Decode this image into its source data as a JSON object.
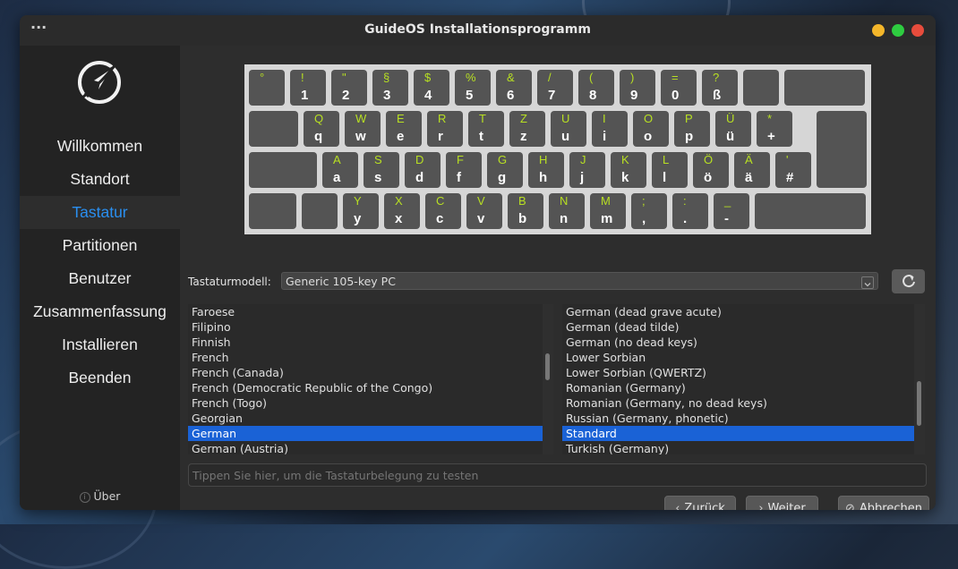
{
  "window": {
    "title": "GuideOS Installationsprogramm",
    "menu_glyph": "···",
    "controls": {
      "minimize_color": "#f4b62a",
      "maximize_color": "#2ecc40",
      "close_color": "#e74c3c"
    }
  },
  "sidebar": {
    "items": [
      {
        "label": "Willkommen",
        "active": false
      },
      {
        "label": "Standort",
        "active": false
      },
      {
        "label": "Tastatur",
        "active": true
      },
      {
        "label": "Partitionen",
        "active": false
      },
      {
        "label": "Benutzer",
        "active": false
      },
      {
        "label": "Zusammenfassung",
        "active": false
      },
      {
        "label": "Installieren",
        "active": false
      },
      {
        "label": "Beenden",
        "active": false
      }
    ],
    "about_label": "Über",
    "active_color": "#2a8ff0"
  },
  "keyboard": {
    "rows": [
      [
        [
          "°",
          ""
        ],
        [
          "!",
          "1"
        ],
        [
          "\"",
          "2"
        ],
        [
          "§",
          "3"
        ],
        [
          "$",
          "4"
        ],
        [
          "%",
          "5"
        ],
        [
          "&",
          "6"
        ],
        [
          "/",
          "7"
        ],
        [
          "(",
          "8"
        ],
        [
          ")",
          "9"
        ],
        [
          "=",
          "0"
        ],
        [
          "?",
          "ß"
        ],
        [
          "",
          ""
        ],
        [
          "",
          ""
        ]
      ],
      [
        [
          "",
          ""
        ],
        [
          "Q",
          "q"
        ],
        [
          "W",
          "w"
        ],
        [
          "E",
          "e"
        ],
        [
          "R",
          "r"
        ],
        [
          "T",
          "t"
        ],
        [
          "Z",
          "z"
        ],
        [
          "U",
          "u"
        ],
        [
          "I",
          "i"
        ],
        [
          "O",
          "o"
        ],
        [
          "P",
          "p"
        ],
        [
          "Ü",
          "ü"
        ],
        [
          "*",
          "+"
        ],
        [
          "",
          ""
        ]
      ],
      [
        [
          "",
          ""
        ],
        [
          "A",
          "a"
        ],
        [
          "S",
          "s"
        ],
        [
          "D",
          "d"
        ],
        [
          "F",
          "f"
        ],
        [
          "G",
          "g"
        ],
        [
          "H",
          "h"
        ],
        [
          "J",
          "j"
        ],
        [
          "K",
          "k"
        ],
        [
          "L",
          "l"
        ],
        [
          "Ö",
          "ö"
        ],
        [
          "Ä",
          "ä"
        ],
        [
          "'",
          "#"
        ]
      ],
      [
        [
          "",
          ""
        ],
        [
          "",
          ""
        ],
        [
          "Y",
          "y"
        ],
        [
          "X",
          "x"
        ],
        [
          "C",
          "c"
        ],
        [
          "V",
          "v"
        ],
        [
          "B",
          "b"
        ],
        [
          "N",
          "n"
        ],
        [
          "M",
          "m"
        ],
        [
          ";",
          ","
        ],
        [
          ":",
          "."
        ],
        [
          "_",
          "-"
        ],
        [
          "",
          ""
        ]
      ]
    ],
    "upper_color": "#b8e022"
  },
  "model": {
    "label": "Tastaturmodell:",
    "value": "Generic 105-key PC",
    "reset_icon": "refresh-icon"
  },
  "layouts": {
    "items": [
      "Faroese",
      "Filipino",
      "Finnish",
      "French",
      "French (Canada)",
      "French (Democratic Republic of the Congo)",
      "French (Togo)",
      "Georgian",
      "German",
      "German (Austria)"
    ],
    "selected": "German"
  },
  "variants": {
    "items": [
      "German (dead grave acute)",
      "German (dead tilde)",
      "German (no dead keys)",
      "Lower Sorbian",
      "Lower Sorbian (QWERTZ)",
      "Romanian (Germany)",
      "Romanian (Germany, no dead keys)",
      "Russian (Germany, phonetic)",
      "Standard",
      "Turkish (Germany)"
    ],
    "selected": "Standard"
  },
  "test_input": {
    "placeholder": "Tippen Sie hier, um die Tastaturbelegung zu testen",
    "value": ""
  },
  "buttons": {
    "back": "Zurück",
    "next": "Weiter",
    "cancel": "Abbrechen"
  },
  "selection_color": "#1a62d6"
}
